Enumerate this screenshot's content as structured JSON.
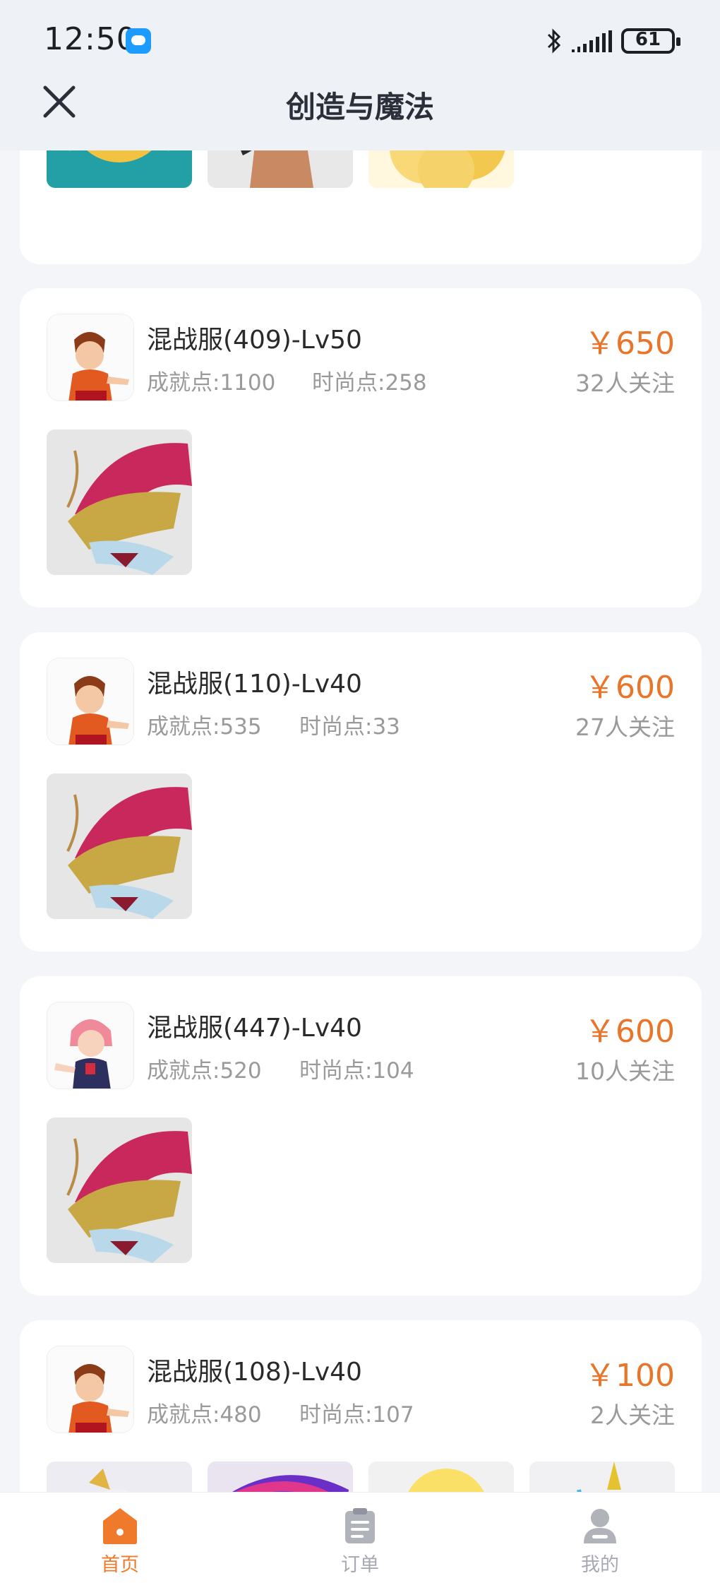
{
  "status": {
    "time": "12:50",
    "battery": "61"
  },
  "header": {
    "title": "创造与魔法"
  },
  "listings": [
    {
      "name": "混战服(409)-Lv50",
      "achievement": "成就点:1100",
      "fashion": "时尚点:258",
      "price": "￥650",
      "followers": "32人关注"
    },
    {
      "name": "混战服(110)-Lv40",
      "achievement": "成就点:535",
      "fashion": "时尚点:33",
      "price": "￥600",
      "followers": "27人关注"
    },
    {
      "name": "混战服(447)-Lv40",
      "achievement": "成就点:520",
      "fashion": "时尚点:104",
      "price": "￥600",
      "followers": "10人关注"
    },
    {
      "name": "混战服(108)-Lv40",
      "achievement": "成就点:480",
      "fashion": "时尚点:107",
      "price": "￥100",
      "followers": "2人关注"
    }
  ],
  "nav": {
    "home": "首页",
    "orders": "订单",
    "mine": "我的"
  },
  "colors": {
    "accent": "#e8752a",
    "active_tab": "#f07a2b",
    "inactive_tab": "#b0b3ba"
  },
  "icons": [
    "close-icon",
    "chat-bubble-icon",
    "bluetooth-icon",
    "signal-icon",
    "battery-icon",
    "home-icon",
    "clipboard-icon",
    "user-icon"
  ]
}
